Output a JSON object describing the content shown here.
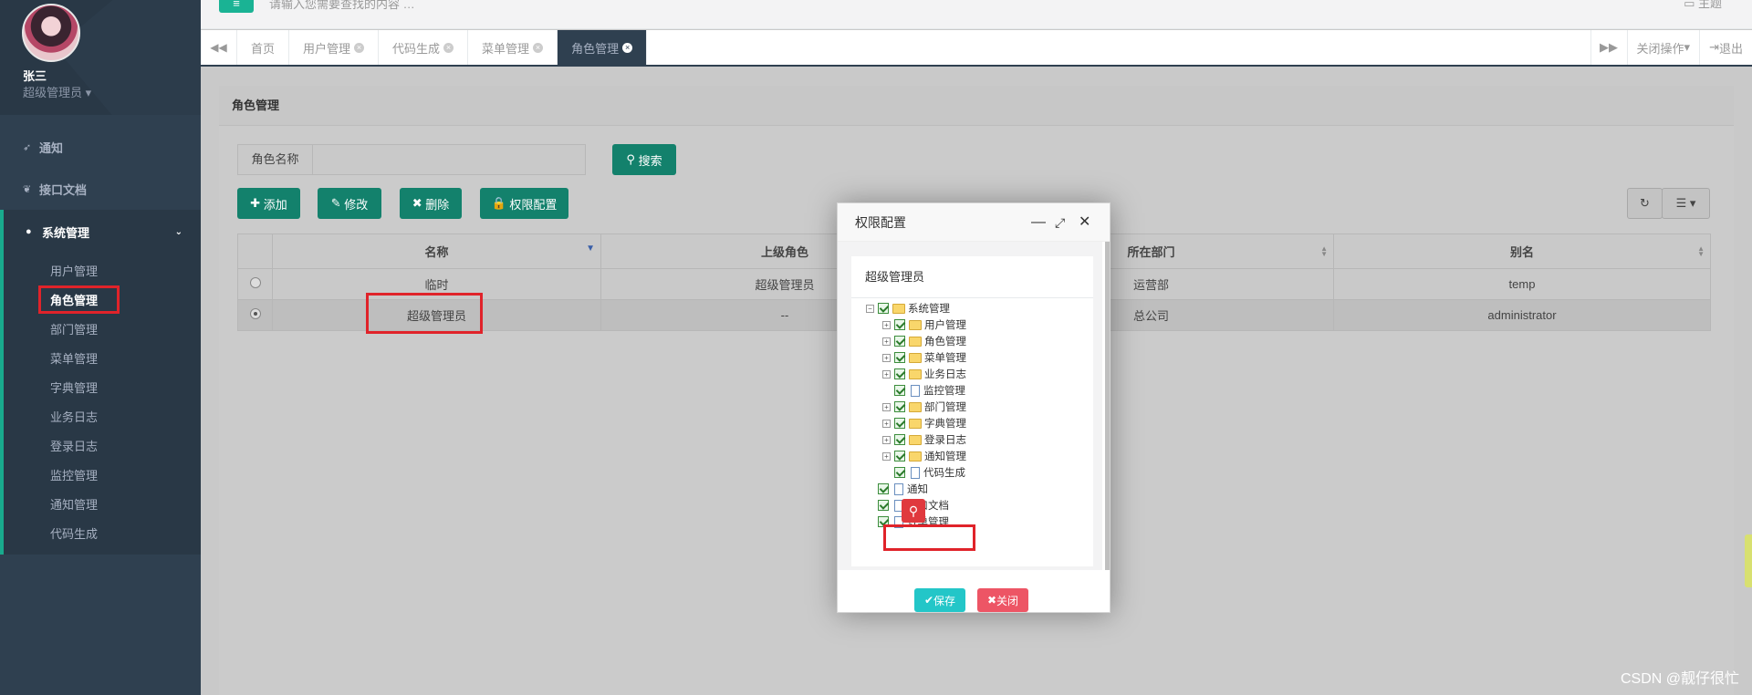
{
  "profile": {
    "name": "张三",
    "role": "超级管理员"
  },
  "sidebar": {
    "items": [
      {
        "label": "通知",
        "icon": "rocket-icon"
      },
      {
        "label": "接口文档",
        "icon": "leaf-icon"
      },
      {
        "label": "系统管理",
        "icon": "user-icon"
      }
    ],
    "subitems": [
      "用户管理",
      "角色管理",
      "部门管理",
      "菜单管理",
      "字典管理",
      "业务日志",
      "登录日志",
      "监控管理",
      "通知管理",
      "代码生成"
    ]
  },
  "topbar": {
    "search_placeholder": "请输入您需要查找的内容 …",
    "theme_label": "主题"
  },
  "tabs": [
    "首页",
    "用户管理",
    "代码生成",
    "菜单管理",
    "角色管理"
  ],
  "tabs_right": {
    "close_ops": "关闭操作",
    "logout": "退出"
  },
  "panel": {
    "title": "角色管理",
    "filter_label": "角色名称",
    "search_btn": "搜索",
    "buttons": {
      "add": "添加",
      "edit": "修改",
      "delete": "删除",
      "perm": "权限配置"
    }
  },
  "table": {
    "headers": [
      "名称",
      "上级角色",
      "所在部门",
      "别名"
    ],
    "rows": [
      {
        "name": "临时",
        "parent": "超级管理员",
        "dept": "运营部",
        "alias": "temp"
      },
      {
        "name": "超级管理员",
        "parent": "--",
        "dept": "总公司",
        "alias": "administrator"
      }
    ]
  },
  "modal": {
    "title": "权限配置",
    "role": "超级管理员",
    "tree": {
      "root": "系统管理",
      "children": [
        "用户管理",
        "角色管理",
        "菜单管理",
        "业务日志",
        "监控管理",
        "部门管理",
        "字典管理",
        "登录日志",
        "通知管理",
        "代码生成"
      ],
      "top_level": [
        "通知",
        "接口文档",
        "订单管理"
      ]
    },
    "save": "保存",
    "close": "关闭"
  },
  "watermark": "CSDN @靓仔很忙"
}
